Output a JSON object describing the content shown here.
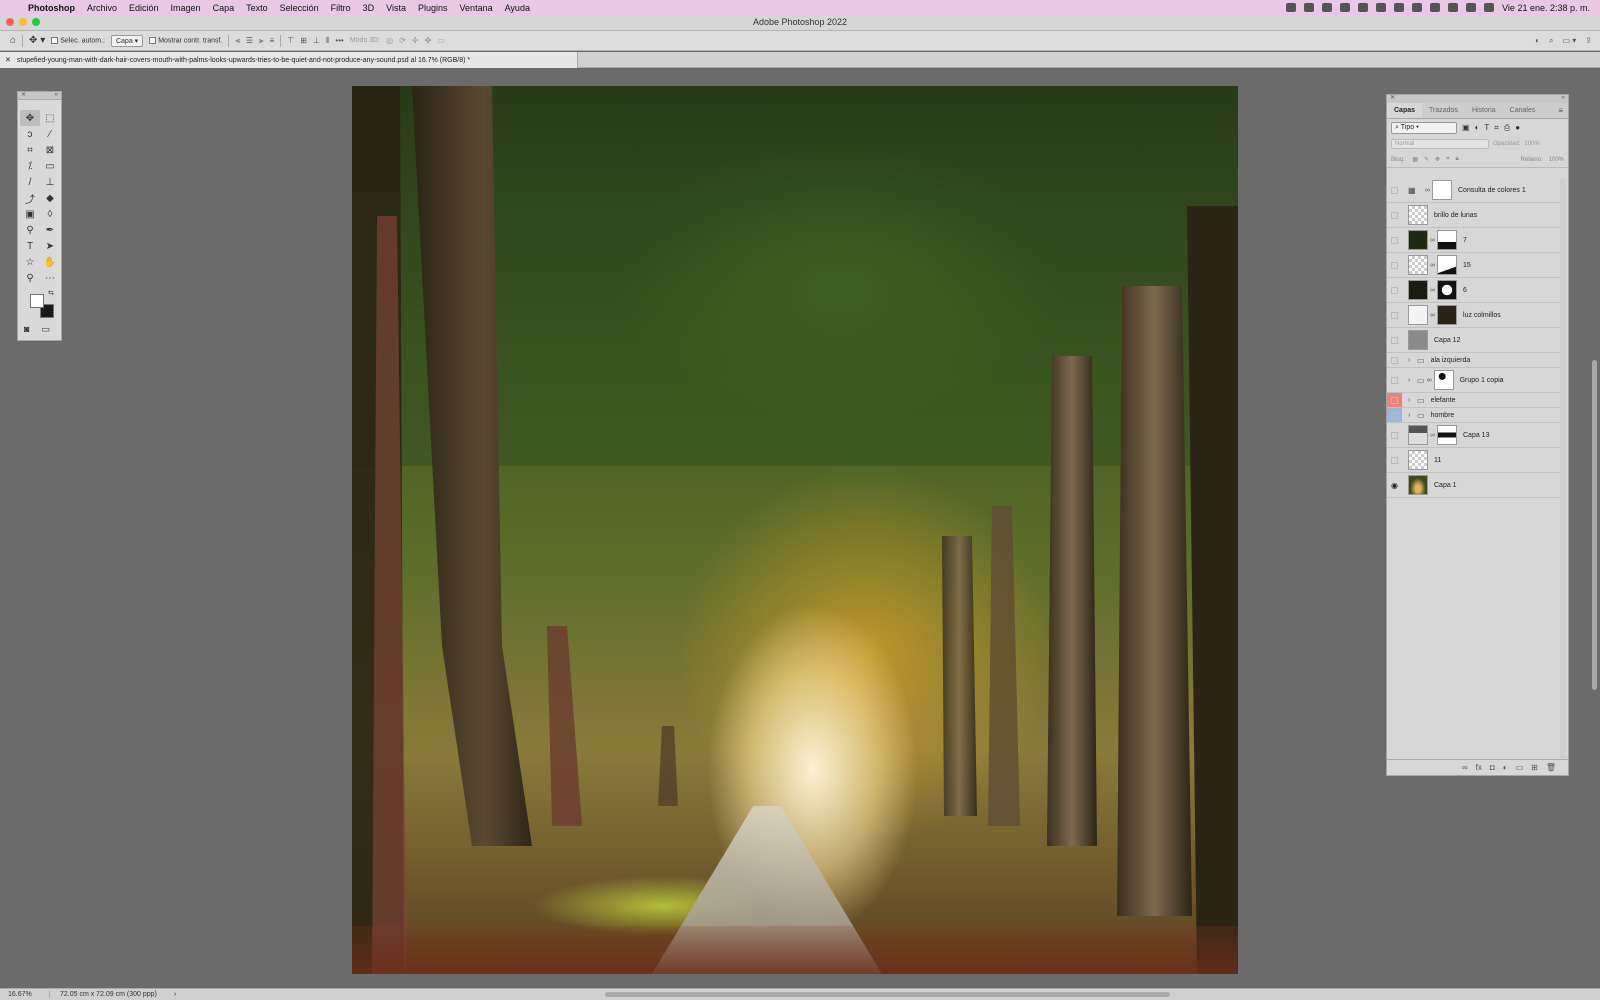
{
  "menubar": {
    "apple_icon": "apple-logo-icon",
    "items": [
      "Photoshop",
      "Archivo",
      "Edición",
      "Imagen",
      "Capa",
      "Texto",
      "Selección",
      "Filtro",
      "3D",
      "Vista",
      "Plugins",
      "Ventana",
      "Ayuda"
    ],
    "clock": "Vie 21 ene.  2:38 p. m."
  },
  "window": {
    "title": "Adobe Photoshop 2022"
  },
  "options_bar": {
    "auto_select_label": "Selec. autom.:",
    "auto_select_value": "Capa",
    "transform_controls_label": "Mostrar contr. transf.",
    "mode_3d_label": "Modo 3D:"
  },
  "document": {
    "tab_title": "stupefied-young-man-with-dark-hair-covers-mouth-with-palms-looks-upwards-tries-to-be-quiet-and-not-produce-any-sound.psd al 16.7% (RGB/8) *"
  },
  "layers_panel": {
    "tabs": [
      "Capas",
      "Trazados",
      "Historia",
      "Canales"
    ],
    "filter_value": "Tipo",
    "blend_mode": "Normal",
    "opacity_label": "Opacidad:",
    "opacity_value": "100%",
    "lock_label": "Bloq.:",
    "fill_label": "Relleno:",
    "fill_value": "100%",
    "layers": [
      {
        "name": "Consulta de colores 1",
        "kind": "adjustment",
        "visible": false,
        "tag": ""
      },
      {
        "name": "brillo de lunas",
        "kind": "pixel",
        "visible": false,
        "tag": ""
      },
      {
        "name": "7",
        "kind": "smart-masked",
        "visible": false,
        "tag": ""
      },
      {
        "name": "15",
        "kind": "smart-masked",
        "visible": false,
        "tag": ""
      },
      {
        "name": "6",
        "kind": "smart-masked",
        "visible": false,
        "tag": ""
      },
      {
        "name": "luz colmillos",
        "kind": "masked-dark",
        "visible": false,
        "tag": ""
      },
      {
        "name": "Capa 12",
        "kind": "gray",
        "visible": false,
        "tag": ""
      },
      {
        "name": "ala izquierda",
        "kind": "group",
        "visible": false,
        "tag": ""
      },
      {
        "name": "Grupo 1 copia",
        "kind": "group-masked",
        "visible": false,
        "tag": ""
      },
      {
        "name": "elefante",
        "kind": "group",
        "visible": false,
        "tag": "#e8837a"
      },
      {
        "name": "hombre",
        "kind": "group",
        "visible": false,
        "tag": "#9db3e0"
      },
      {
        "name": "Capa 13",
        "kind": "smart-masked",
        "visible": false,
        "tag": ""
      },
      {
        "name": "11",
        "kind": "smart",
        "visible": false,
        "tag": ""
      },
      {
        "name": "Capa 1",
        "kind": "photo",
        "visible": true,
        "tag": ""
      }
    ]
  },
  "statusbar": {
    "zoom": "16.67%",
    "doc_info": "72.05 cm x 72.09 cm (300 ppp)"
  },
  "colors": {
    "menubar_bg": "#e8c8e4",
    "traffic_close": "#ff5f57",
    "traffic_min": "#febc2e",
    "traffic_max": "#28c840",
    "workspace_bg": "#6b6b6b"
  }
}
